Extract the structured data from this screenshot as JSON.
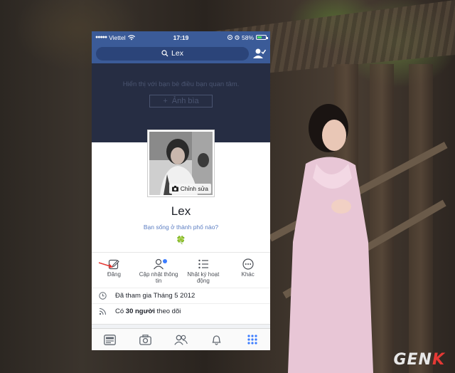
{
  "status_bar": {
    "carrier": "Viettel",
    "time": "17:19",
    "battery": "58%",
    "battery_level": 0.58
  },
  "search": {
    "query": "Lex"
  },
  "cover": {
    "hint": "Hiển thị với bạn bè điều bạn quan tâm.",
    "add_cover_label": "Ảnh bìa"
  },
  "profile": {
    "edit_photo_label": "Chỉnh sửa",
    "name": "Lex",
    "city_prompt": "Bạn sống ở thành phố nào?",
    "emoji": "🍀"
  },
  "actions": [
    {
      "label": "Đăng",
      "icon": "pencil-icon"
    },
    {
      "label": "Cập nhật thông tin",
      "icon": "person-icon"
    },
    {
      "label": "Nhật ký hoạt động",
      "icon": "list-icon"
    },
    {
      "label": "Khác",
      "icon": "more-icon"
    }
  ],
  "info": {
    "joined": "Đã tham gia Tháng 5 2012",
    "followers_prefix": "Có",
    "followers_count": "30 người",
    "followers_suffix": "theo dõi"
  },
  "tabs": [
    "news-feed-icon",
    "camera-icon",
    "friends-icon",
    "bell-icon",
    "menu-grid-icon"
  ],
  "watermark": "GENK",
  "colors": {
    "brand_blue": "#3b5b98",
    "cover_dark": "#262d43",
    "link_blue": "#5b7dc2",
    "accent_red": "#e53935"
  }
}
